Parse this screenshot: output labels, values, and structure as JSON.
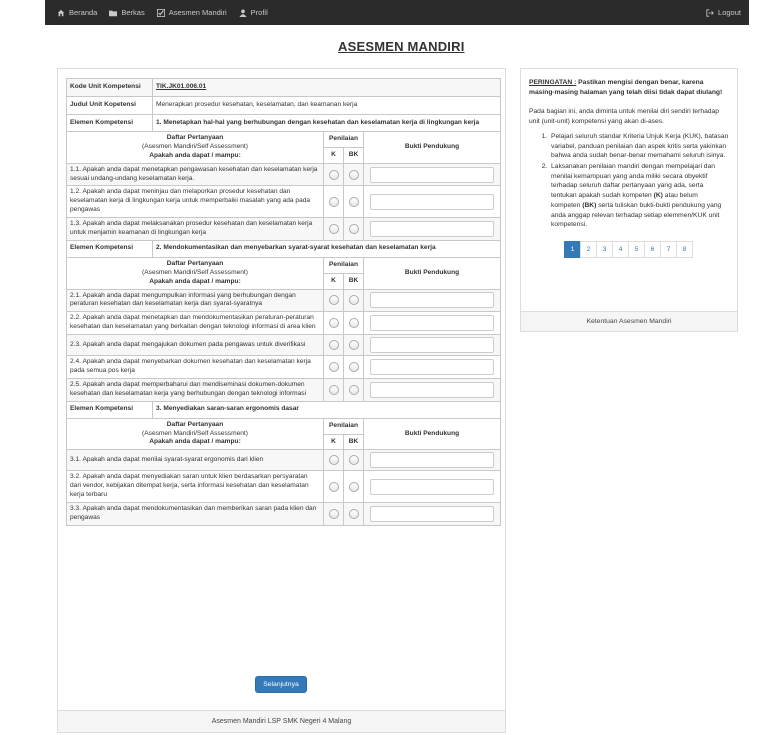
{
  "nav": {
    "items": [
      {
        "label": "Beranda",
        "icon": "home-icon"
      },
      {
        "label": "Berkas",
        "icon": "folder-icon"
      },
      {
        "label": "Asesmen Mandiri",
        "icon": "check-icon"
      },
      {
        "label": "Profil",
        "icon": "user-icon"
      }
    ],
    "logout": "Logout"
  },
  "page": {
    "title": "ASESMEN MANDIRI"
  },
  "info": {
    "kode_label": "Kode Unit Kompetensi",
    "kode_value": "TIK.JK01.006.01",
    "judul_label": "Judul Unit Kopetensi",
    "judul_value": "Menerapkan prosedur kesehatan, keselamatan, dan keamanan kerja"
  },
  "table_header": {
    "title": "Daftar Pertanyaan",
    "subtitle": "(Asesmen Mandiri/Self Assessment)",
    "prompt": "Apakah anda dapat / mampu:",
    "penilaian": "Penilaian",
    "k": "K",
    "bk": "BK",
    "bukti": "Bukti Pendukung"
  },
  "elemen_label": "Elemen Kompetensi",
  "elemen": [
    {
      "title": "1. Menetapkan hal-hal yang berhubungan dengan kesehatan dan keselamatan kerja di lingkungan kerja",
      "questions": [
        "1.1. Apakah anda dapat menetapkan pengawasan kesehatan dan keselamatan kerja sesuai undang-undang keselamatan kerja.",
        "1.2. Apakah anda dapat meninjau dan melaporkan prosedur kesehatan dan keselamatan kerja di lingkungan kerja untuk memperbaiki masalah yang ada pada pengawas",
        "1.3. Apakah anda dapat melaksanakan prosedur kesehatan dan keselamatan kerja untuk menjamin keamanan di lingkungan kerja"
      ]
    },
    {
      "title": "2. Mendokumentasikan dan menyebarkan syarat-syarat kesehatan dan keselamatan kerja",
      "questions": [
        "2.1. Apakah anda dapat mengumpulkan informasi yang berhubungan dengan peraturan kesehatan dan keselamatan kerja dan syarat-syaratnya",
        "2.2. Apakah anda dapat menetapkan dan mendokumentasikan peraturan-peraturan kesehatan dan keselamatan yang berkaitan dengan teknologi informasi di area klien",
        "2.3. Apakah anda dapat mengajukan dokumen pada pengawas untuk diverifikasi",
        "2.4. Apakah anda dapat menyebarkan dokumen kesehatan dan keselamatan kerja pada semua pos kerja",
        "2.5. Apakah anda dapat memperbaharui dan mendiseminasi dokumen-dokumen kesehatan dan keselamatan kerja yang berhubungan dengan teknologi informasi"
      ]
    },
    {
      "title": "3. Menyediakan saran-saran ergonomis dasar",
      "questions": [
        "3.1. Apakah anda dapat menilai syarat-syarat ergonomis dari klien",
        "3.2. Apakah anda dapat menyediakan saran untuk klien berdasarkan persyaratan dari vendor, kebijakan ditempat kerja, serta informasi kesehatan dan keselamatan kerja terbaru",
        "3.3. Apakah anda dapat mendokumentasikan dan memberikan saran pada klien dan pengawas"
      ]
    }
  ],
  "buttons": {
    "next": "Selanjutnya"
  },
  "main_footer": "Asesmen Mandiri LSP SMK Negeri 4 Malang",
  "side": {
    "warn_label": "PERINGATAN :",
    "warn_text": " Pastikan mengisi dengan benar, karena masing-masing halaman yang telah diisi tidak dapat diulang!",
    "intro": "Pada bagian ini, anda diminta untuk menilai diri sendiri terhadap unit (unit-unit) kompetensi yang akan di-ases.",
    "points": [
      "Pelajari seluruh standar Kriteria Unjuk Kerja (KUK), batasan variabel, panduan penilaian dan aspek kritis serta yakinkan bahwa anda sudah benar-benar memahami seluruh isinya.",
      "Laksanakan penilaian mandiri dengan mempelajari dan menilai kemampuan yang anda miliki secara obyektif terhadap seluruh daftar pertanyaan yang ada, serta tentukan apakah sudah kompeten (K) atau belum kompeten (BK) serta tuliskan bukti-bukti pendukung yang anda anggap relevan terhadap setiap elemmen/KUK unit kompetensi."
    ],
    "pages": [
      "1",
      "2",
      "3",
      "4",
      "5",
      "6",
      "7",
      "8"
    ],
    "active_page": "1",
    "footer": "Ketentuan Asesmen Mandiri"
  },
  "colors": {
    "navbar": "#2b2b2b",
    "primary": "#337ab7"
  }
}
